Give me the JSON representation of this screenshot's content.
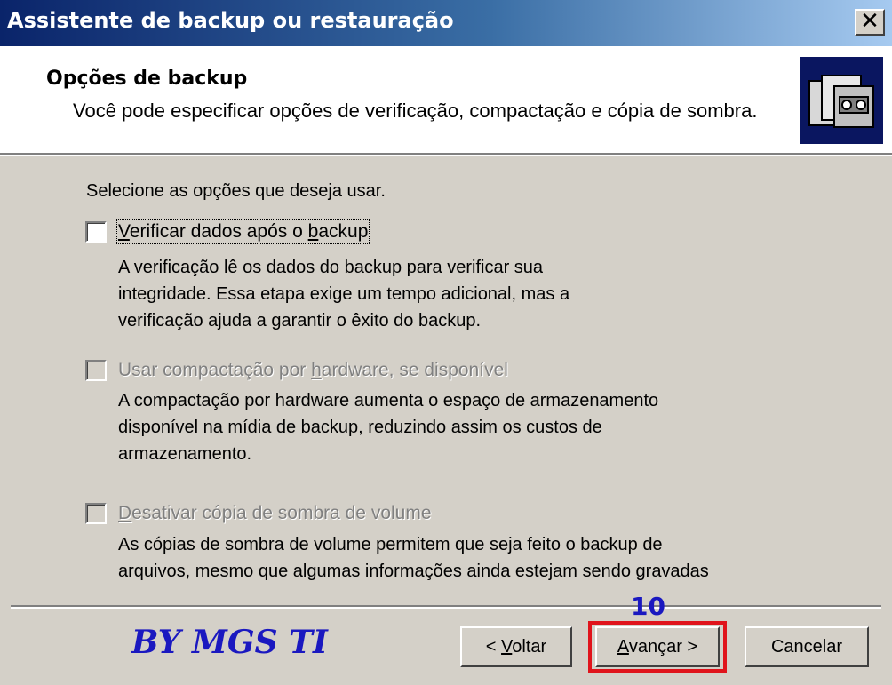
{
  "window": {
    "title": "Assistente de backup ou restauração",
    "close_symbol": "✕"
  },
  "header": {
    "title": "Opções de backup",
    "subtitle": "Você pode especificar opções de verificação, compactação e cópia de sombra.",
    "icon": "backup-tape-icon"
  },
  "content": {
    "instruction": "Selecione as opções que deseja usar.",
    "options": [
      {
        "label_parts": [
          "V",
          "erificar dados após o ",
          "b",
          "ackup"
        ],
        "checked": false,
        "enabled": true,
        "description_lines": [
          "A verificação lê os dados do backup para verificar sua",
          "integridade. Essa etapa exige um tempo adicional, mas a",
          "verificação ajuda a garantir o êxito do backup."
        ]
      },
      {
        "label_parts": [
          "Usar compactação por ",
          "h",
          "ardware, se disponível"
        ],
        "checked": false,
        "enabled": false,
        "description_lines": [
          "A compactação por hardware aumenta o espaço de armazenamento",
          "disponível na mídia de backup, reduzindo assim os custos de",
          "armazenamento."
        ]
      },
      {
        "label_parts": [
          "D",
          "esativar cópia de sombra de volume"
        ],
        "checked": false,
        "enabled": false,
        "description_lines": [
          "As cópias de sombra de volume permitem que seja feito o backup de",
          "arquivos, mesmo que algumas informações ainda estejam sendo gravadas"
        ]
      }
    ]
  },
  "footer": {
    "watermark": "BY MGS TI",
    "step_number": "10",
    "back_parts": [
      "< ",
      "V",
      "oltar"
    ],
    "next_parts": [
      "A",
      "vançar >"
    ],
    "cancel_label": "Cancelar"
  },
  "colors": {
    "titlebar_start": "#0a246a",
    "titlebar_end": "#a6caf0",
    "face": "#d4d0c8",
    "annotation_blue": "#1a18c0",
    "highlight_red": "#e0141c"
  }
}
